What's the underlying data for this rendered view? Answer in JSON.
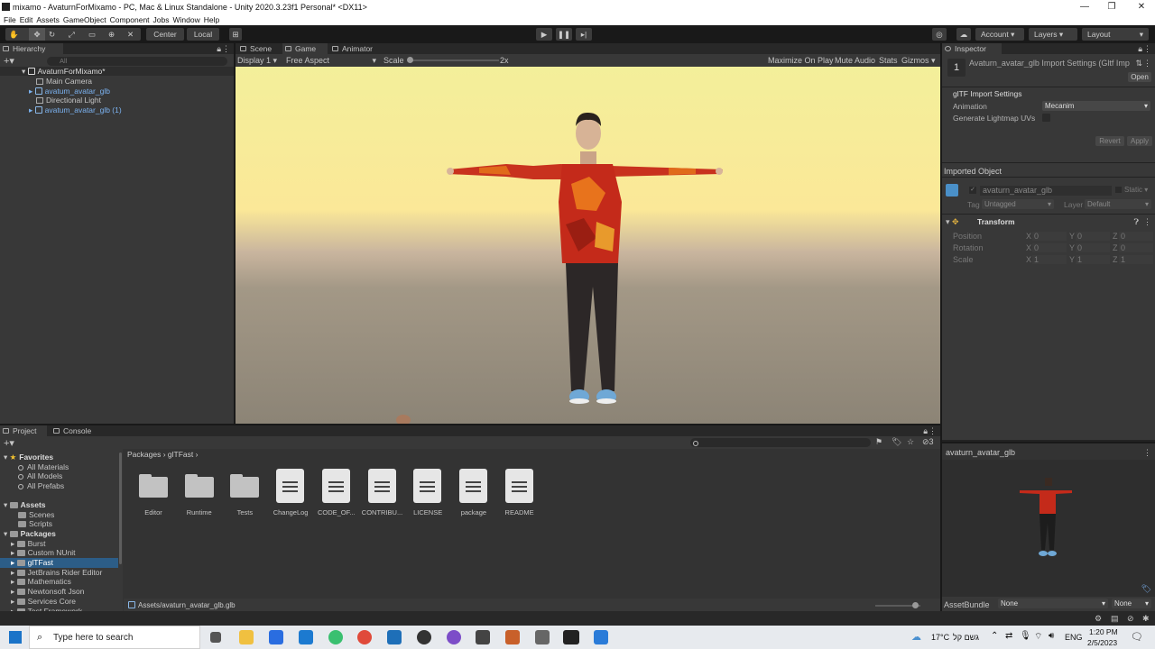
{
  "window": {
    "title": "mixamo - AvaturnForMixamo - PC, Mac & Linux Standalone - Unity 2020.3.23f1 Personal* <DX11>"
  },
  "menu": [
    "File",
    "Edit",
    "Assets",
    "GameObject",
    "Component",
    "Jobs",
    "Window",
    "Help"
  ],
  "toolbar": {
    "center": "Center",
    "local": "Local",
    "account": "Account",
    "layers": "Layers",
    "layout": "Layout"
  },
  "hierarchy": {
    "tab": "Hierarchy",
    "search_placeholder": "All",
    "scene": "AvaturnForMixamo*",
    "items": [
      "Main Camera",
      "avatum_avatar_glb",
      "Directional Light",
      "avatum_avatar_glb (1)"
    ]
  },
  "view_tabs": [
    "Scene",
    "Game",
    "Animator"
  ],
  "game_bar": {
    "display": "Display 1",
    "aspect": "Free Aspect",
    "scale_label": "Scale",
    "scale_value": "2x",
    "maximize": "Maximize On Play",
    "mute": "Mute Audio",
    "stats": "Stats",
    "gizmos": "Gizmos"
  },
  "inspector": {
    "tab": "Inspector",
    "header": "Avaturn_avatar_glb Import Settings (Gltf Imp",
    "open": "Open",
    "section": "glTF Import Settings",
    "animation_label": "Animation",
    "animation_value": "Mecanim",
    "lightmap_label": "Generate Lightmap UVs",
    "revert": "Revert",
    "apply": "Apply",
    "imported_object": "Imported Object",
    "object_name": "avaturn_avatar_glb",
    "static": "Static",
    "tag_label": "Tag",
    "tag_value": "Untagged",
    "layer_label": "Layer",
    "layer_value": "Default",
    "transform": "Transform",
    "transform_rows": [
      {
        "label": "Position",
        "x": "0",
        "y": "0",
        "z": "0"
      },
      {
        "label": "Rotation",
        "x": "0",
        "y": "0",
        "z": "0"
      },
      {
        "label": "Scale",
        "x": "1",
        "y": "1",
        "z": "1"
      }
    ],
    "preview_title": "avaturn_avatar_glb",
    "assetbundle_label": "AssetBundle",
    "assetbundle_value": "None",
    "assetbundle_variant": "None"
  },
  "project": {
    "tabs": [
      "Project",
      "Console"
    ],
    "favorites": {
      "label": "Favorites",
      "items": [
        "All Materials",
        "All Models",
        "All Prefabs"
      ]
    },
    "assets": {
      "label": "Assets",
      "items": [
        "Scenes",
        "Scripts"
      ]
    },
    "packages": {
      "label": "Packages",
      "items": [
        "Burst",
        "Custom NUnit",
        "glTFast",
        "JetBrains Rider Editor",
        "Mathematics",
        "Newtonsoft Json",
        "Services Core",
        "Test Framework"
      ]
    },
    "breadcrumb": [
      "Packages",
      "glTFast"
    ],
    "files": [
      "Editor",
      "Runtime",
      "Tests",
      "ChangeLog",
      "CODE_OF...",
      "CONTRIBU...",
      "LICENSE",
      "package",
      "README"
    ],
    "status_path": "Assets/avaturn_avatar_glb.glb",
    "count": "3"
  },
  "taskbar": {
    "search": "Type here to search",
    "weather": "17°C",
    "weather_text": "גשם קל",
    "lang": "ENG",
    "time": "1:20 PM",
    "date": "2/5/2023"
  }
}
